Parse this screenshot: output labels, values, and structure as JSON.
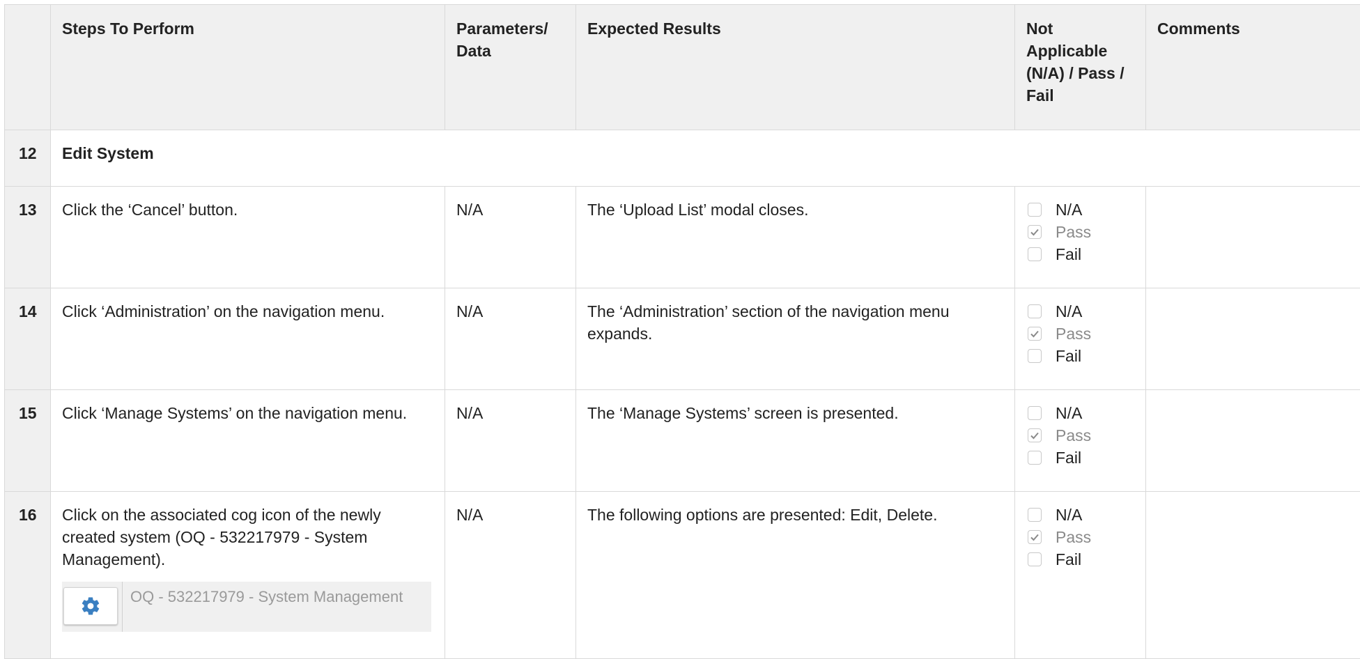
{
  "table": {
    "headers": {
      "steps": "Steps To Perform",
      "params": "Parameters/ Data",
      "expected": "Expected Results",
      "status": "Not Applicable (N/A) / Pass / Fail",
      "comments": "Comments"
    },
    "section": {
      "number": "12",
      "title": "Edit System"
    },
    "rows": [
      {
        "number": "13",
        "step": "Click the ‘Cancel’ button.",
        "params": "N/A",
        "expected": "The ‘Upload List’ modal closes."
      },
      {
        "number": "14",
        "step": "Click ‘Administration’ on the navigation menu.",
        "params": "N/A",
        "expected": "The ‘Administration’ section of the navigation menu expands."
      },
      {
        "number": "15",
        "step": "Click ‘Manage Systems’ on the navigation menu.",
        "params": "N/A",
        "expected": "The ‘Manage Systems’ screen is presented."
      },
      {
        "number": "16",
        "step": "Click on the associated cog icon of the newly created system (OQ - 532217979 - System Management).",
        "params": "N/A",
        "expected": "The following options are presented: Edit, Delete.",
        "screenshot_text": "OQ - 532217979 - System Management"
      }
    ],
    "status_options": {
      "na": "N/A",
      "pass": "Pass",
      "fail": "Fail"
    },
    "selected_status": "Pass"
  },
  "icons": {
    "cog": "cog-icon",
    "check": "check-icon"
  },
  "colors": {
    "header_bg": "#f0f0f0",
    "border": "#d9d9d9",
    "cog_blue": "#3a7fc1"
  }
}
